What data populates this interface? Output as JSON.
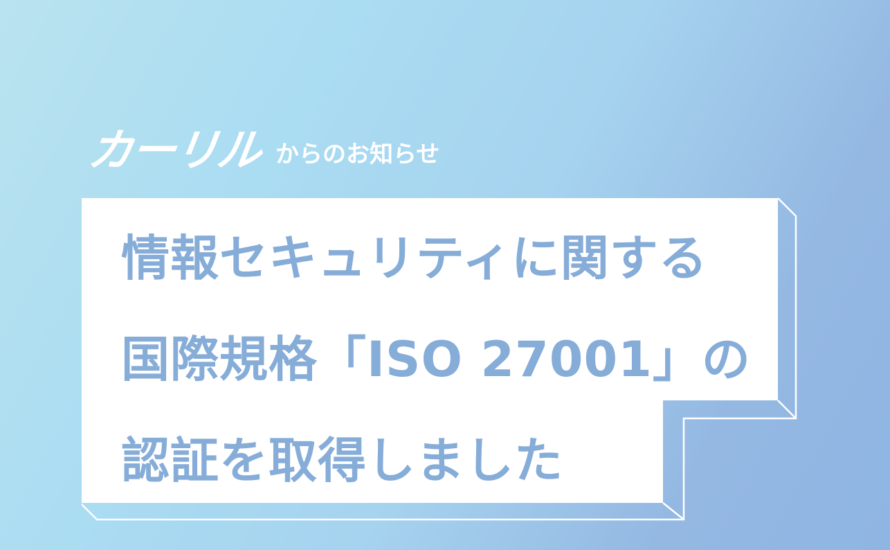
{
  "brand": {
    "logo_text": "カーリル",
    "suffix": "からのお知らせ"
  },
  "headline": {
    "lines": [
      "情報セキュリティに関する",
      "国際規格「ISO 27001」の",
      "認証を取得しました"
    ]
  },
  "colors": {
    "title_text": "#86acd8",
    "panel": "#ffffff",
    "background_start": "#b9e3ef",
    "background_end": "#8fb5e3"
  }
}
